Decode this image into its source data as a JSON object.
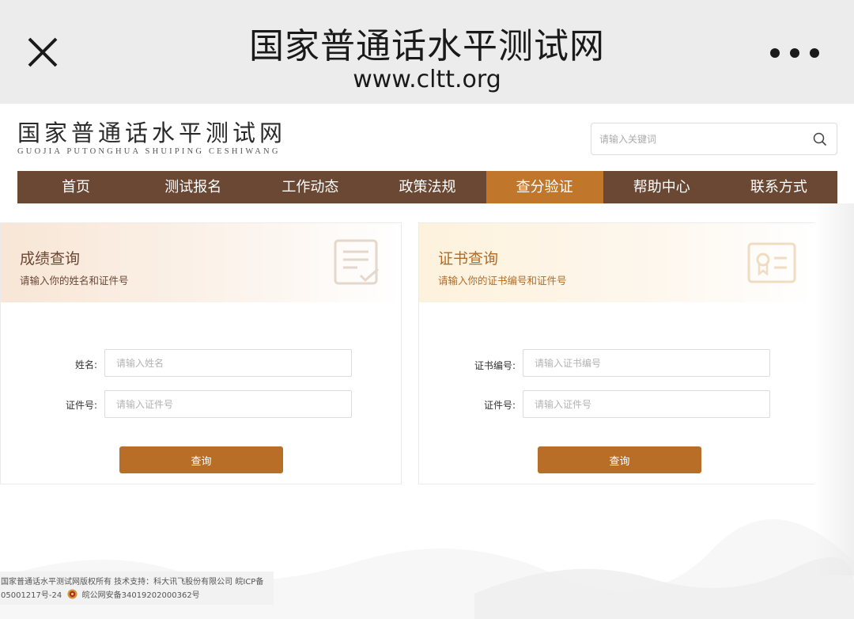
{
  "browser": {
    "title": "国家普通话水平测试网",
    "url": "www.cltt.org"
  },
  "site": {
    "logo_cn": "国家普通话水平测试网",
    "logo_pinyin": "GUOJIA PUTONGHUA SHUIPING CESHIWANG",
    "search_placeholder": "请输入关键词"
  },
  "nav": {
    "items": [
      "首页",
      "测试报名",
      "工作动态",
      "政策法规",
      "查分验证",
      "帮助中心",
      "联系方式"
    ],
    "active_index": 4
  },
  "score_query": {
    "title": "成绩查询",
    "subtitle": "请输入你的姓名和证件号",
    "name_label": "姓名:",
    "name_placeholder": "请输入姓名",
    "id_label": "证件号:",
    "id_placeholder": "请输入证件号",
    "button": "查询"
  },
  "cert_query": {
    "title": "证书查询",
    "subtitle": "请输入你的证书编号和证件号",
    "cert_label": "证书编号:",
    "cert_placeholder": "请输入证书编号",
    "id_label": "证件号:",
    "id_placeholder": "请输入证件号",
    "button": "查询"
  },
  "footer": {
    "line1": "国家普通话水平测试网版权所有 技术支持：科大讯飞股份有限公司 皖ICP备",
    "line2_prefix": "05001217号-24",
    "line2_suffix": "皖公网安备34019202000362号"
  },
  "colors": {
    "nav_bg": "#6b4834",
    "nav_active": "#c0762b",
    "button": "#b86e27"
  }
}
